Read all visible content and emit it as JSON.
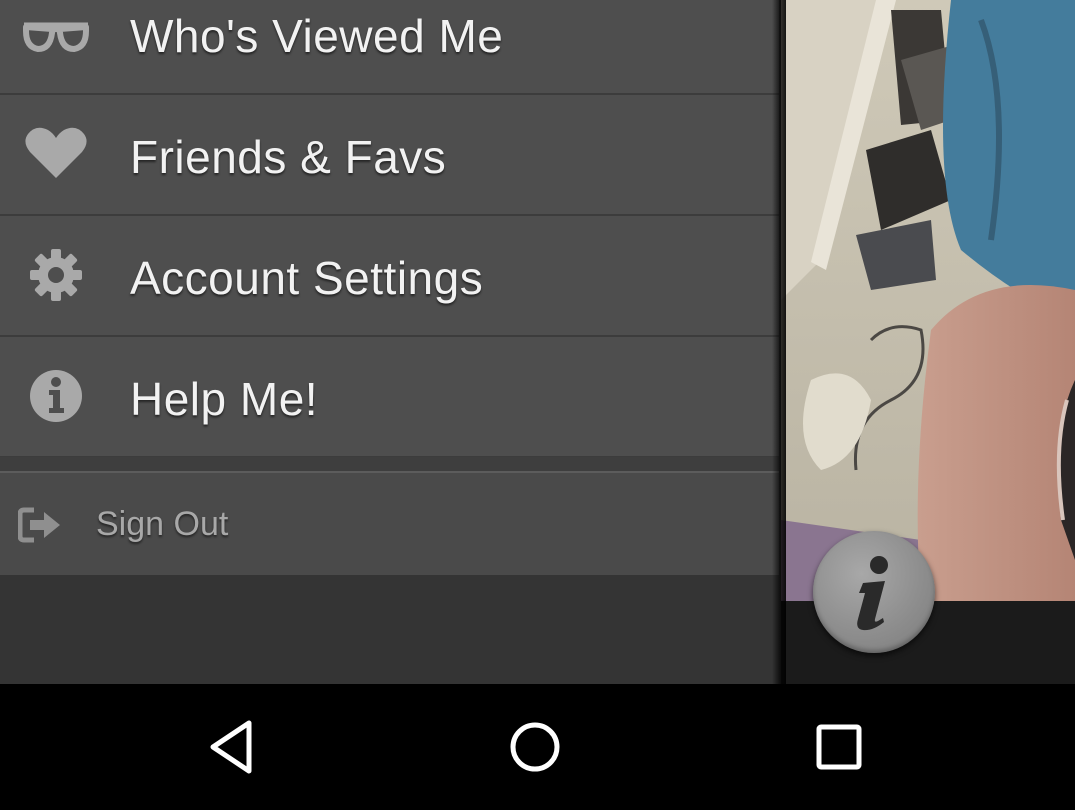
{
  "drawer": {
    "items": [
      {
        "label": "Who's Viewed Me",
        "icon": "glasses-icon"
      },
      {
        "label": "Friends & Favs",
        "icon": "heart-icon"
      },
      {
        "label": "Account Settings",
        "icon": "gear-icon"
      },
      {
        "label": "Help Me!",
        "icon": "info-circle-icon"
      }
    ],
    "sign_out": {
      "label": "Sign Out",
      "icon": "sign-out-icon"
    }
  },
  "profile_panel": {
    "info_button_icon": "info-icon"
  },
  "navbar": {
    "back_icon": "back-triangle-icon",
    "home_icon": "home-circle-icon",
    "recents_icon": "recents-square-icon"
  },
  "colors": {
    "drawer_item_bg": "#4e4e4e",
    "drawer_bg": "#343434",
    "label_text": "#f2f2f2",
    "icon_gray": "#a9a9a9",
    "sign_out_text": "#a8a8a8",
    "navbar_bg": "#000000"
  }
}
